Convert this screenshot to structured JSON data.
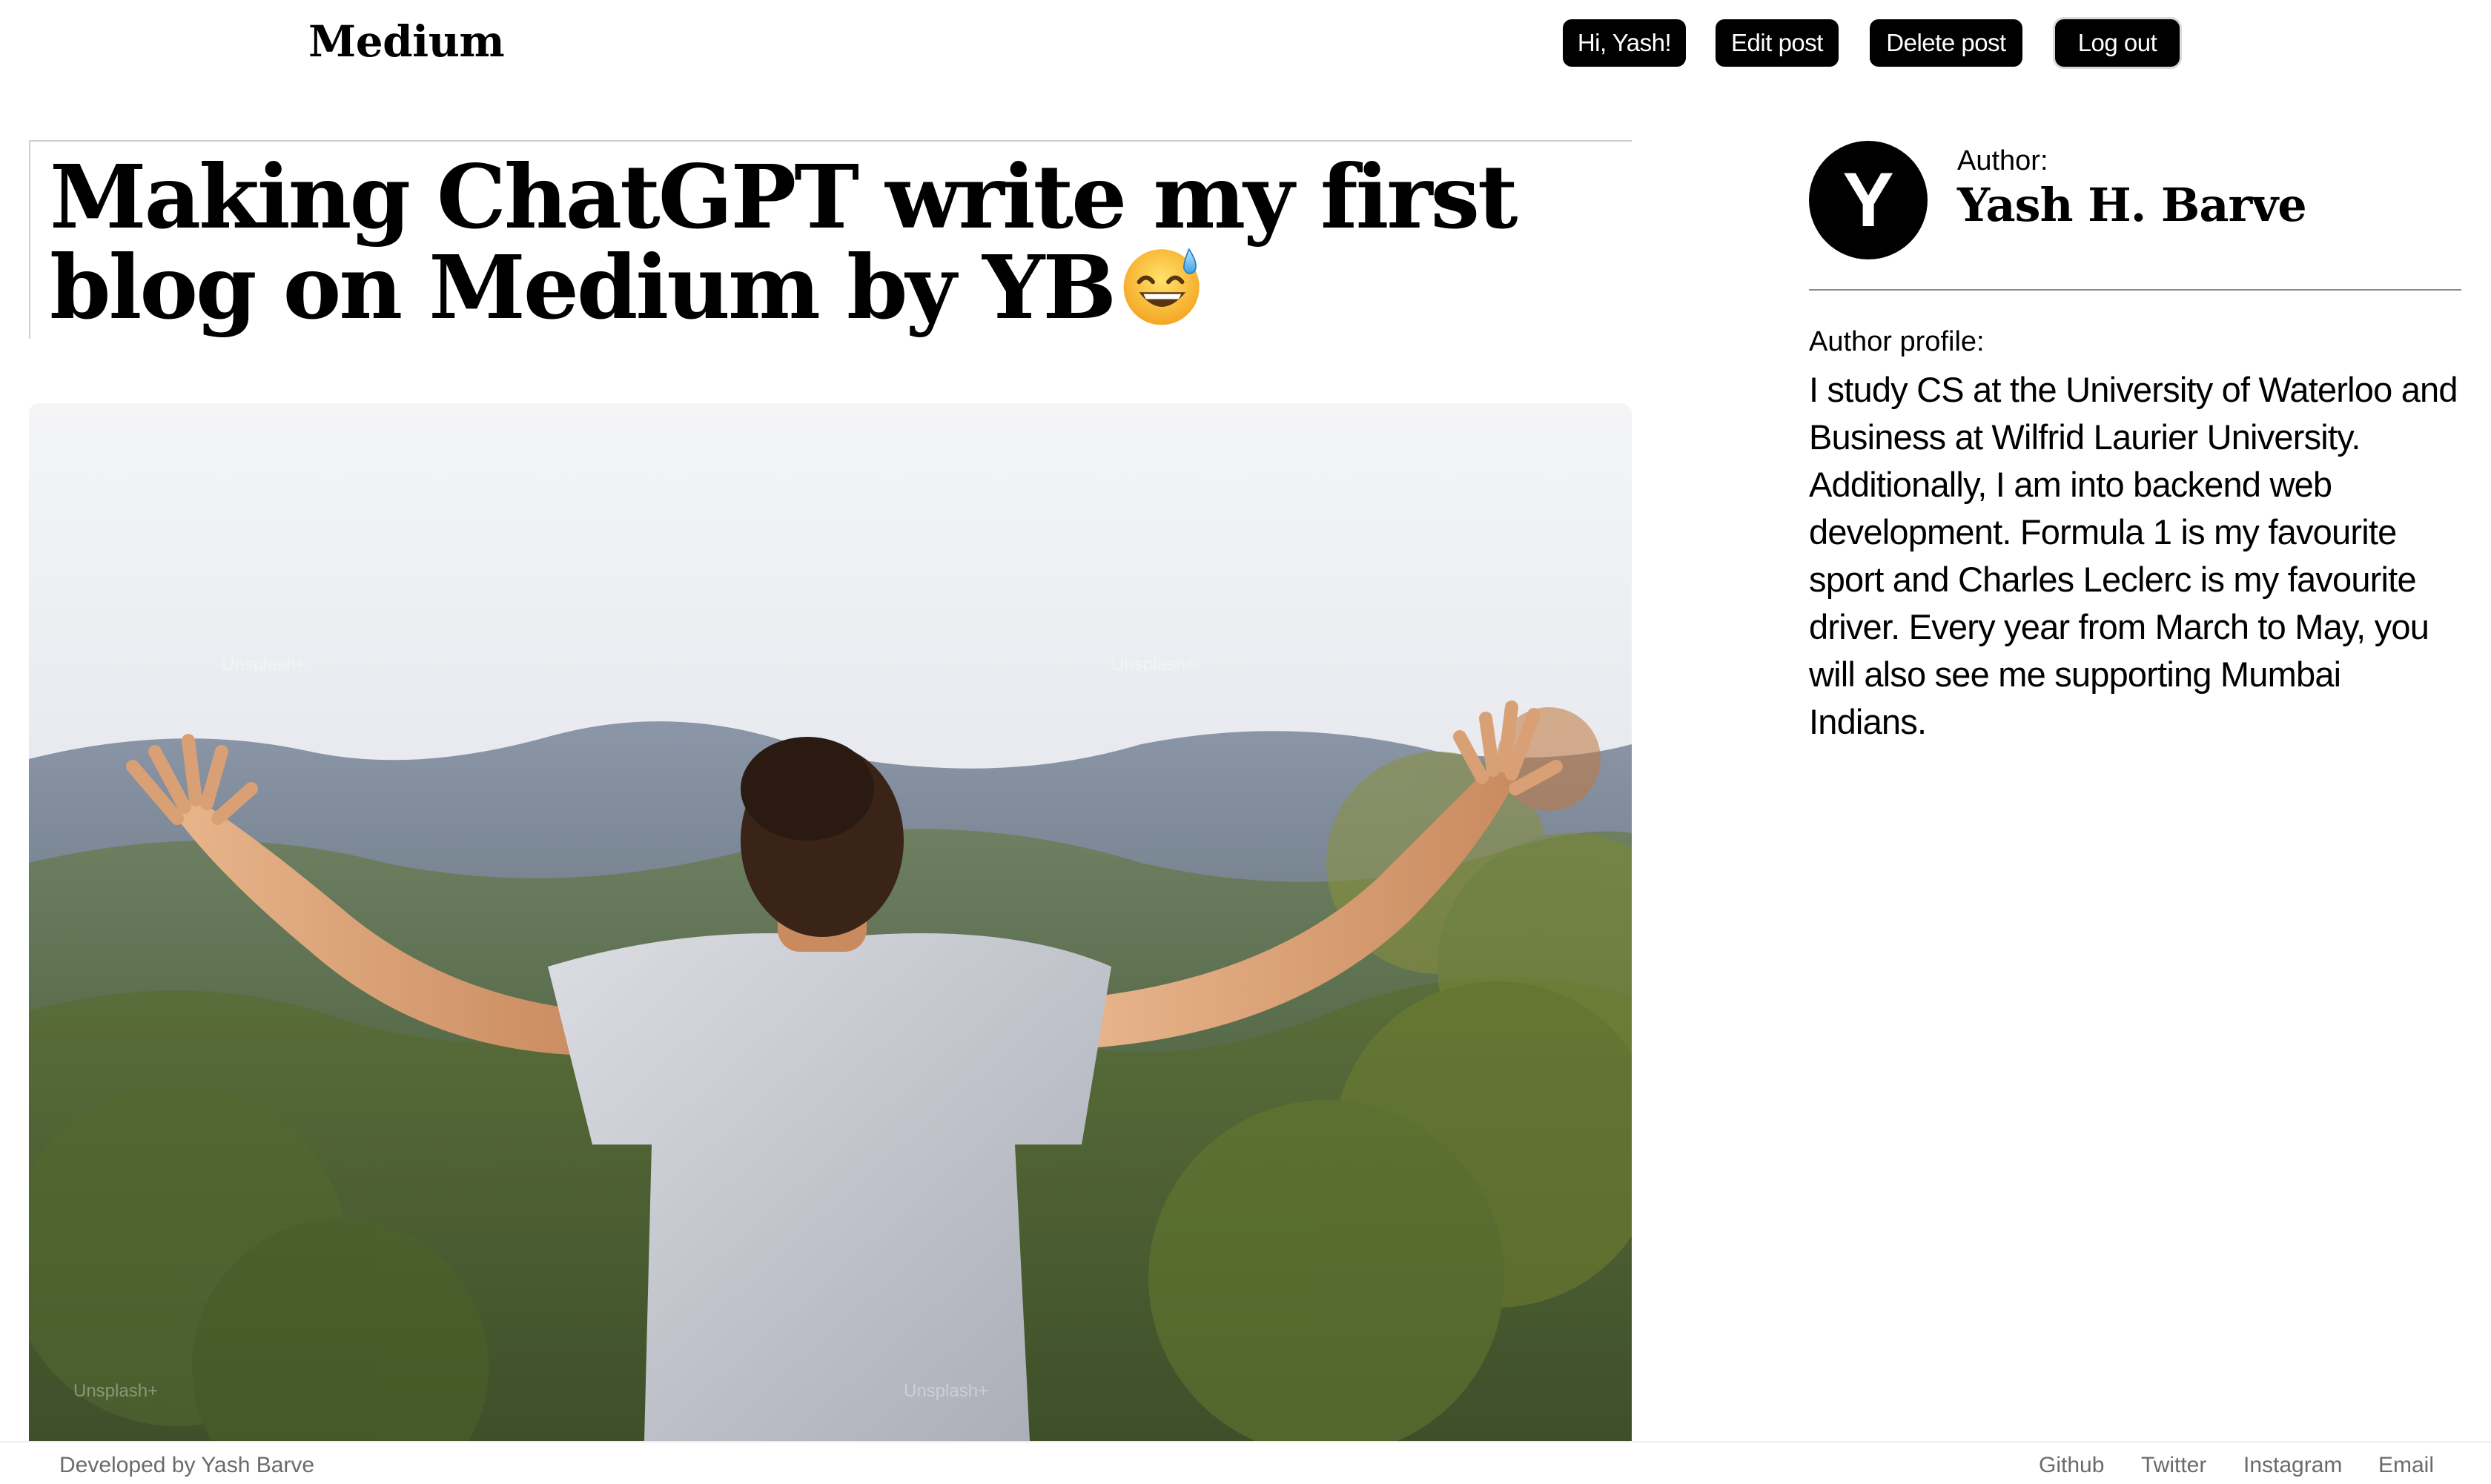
{
  "header": {
    "logo": "Medium",
    "greeting": "Hi, Yash!",
    "edit_label": "Edit post",
    "delete_label": "Delete post",
    "logout_label": "Log out"
  },
  "post": {
    "title": "Making ChatGPT write my first blog on Medium by YB",
    "title_emoji": "grinning-face-with-sweat-icon",
    "cover_image_watermark": "Unsplash+"
  },
  "sidebar": {
    "avatar_initial": "Y",
    "author_label": "Author:",
    "author_name": "Yash H. Barve",
    "profile_label": "Author profile:",
    "profile_text": "I study CS at the University of Waterloo and Business at Wilfrid Laurier University. Additionally, I am into backend web development. Formula 1 is my favourite sport and Charles Leclerc is my favourite driver. Every year from March to May, you will also see me supporting Mumbai Indians."
  },
  "footer": {
    "credit": "Developed by Yash Barve",
    "links": [
      "Github",
      "Twitter",
      "Instagram",
      "Email"
    ]
  },
  "colors": {
    "button_bg": "#000000",
    "button_text": "#ffffff",
    "footer_text": "#6b6b6b"
  }
}
